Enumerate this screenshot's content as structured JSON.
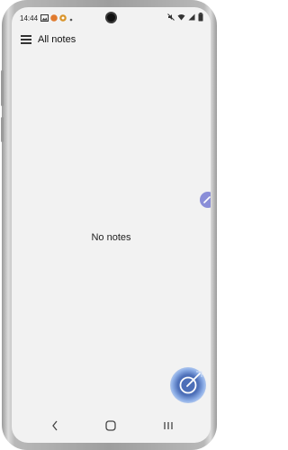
{
  "status_bar": {
    "time": "14:44",
    "notification_icons": [
      "gallery-icon",
      "notification-badge-icon",
      "app-icon",
      "dot-icon"
    ],
    "status_icons": [
      "mute-icon",
      "wifi-icon",
      "signal-icon",
      "battery-icon"
    ]
  },
  "app_bar": {
    "title": "All notes",
    "menu_icon": "hamburger-menu-icon"
  },
  "main": {
    "empty_message": "No notes"
  },
  "fab": {
    "icon": "pen-write-icon",
    "accent": "#4d6fb8"
  },
  "edge_panel": {
    "icon": "edge-panel-handle-icon",
    "color": "#8a8ed8"
  },
  "nav_bar": {
    "buttons": [
      "back-icon",
      "home-icon",
      "recents-icon"
    ]
  }
}
